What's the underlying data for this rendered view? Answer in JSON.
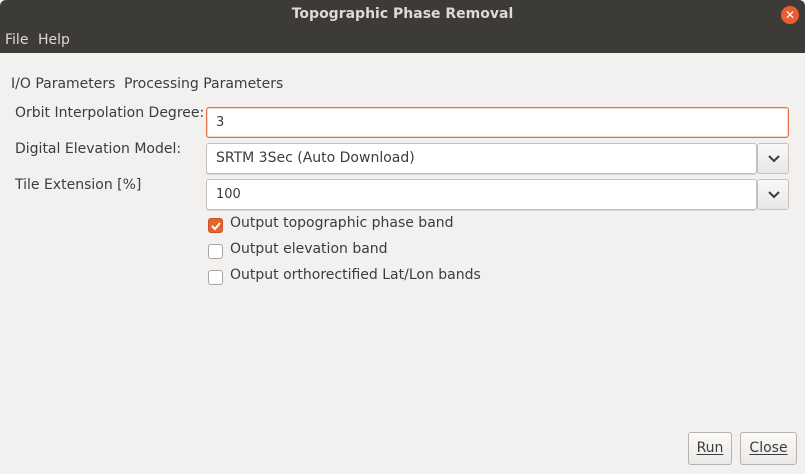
{
  "window": {
    "title": "Topographic Phase Removal",
    "close_glyph": "✕"
  },
  "menu": {
    "items": [
      "File",
      "Help"
    ]
  },
  "tabs": [
    "I/O Parameters",
    "Processing Parameters"
  ],
  "form": {
    "orbit_degree": {
      "label": "Orbit Interpolation Degree:",
      "value": "3"
    },
    "dem": {
      "label": "Digital Elevation Model:",
      "value": "SRTM 3Sec (Auto Download)"
    },
    "tile_extension": {
      "label": "Tile Extension [%]",
      "value": "100"
    },
    "checkboxes": [
      {
        "label": "Output topographic phase band",
        "checked": true
      },
      {
        "label": "Output elevation band",
        "checked": false
      },
      {
        "label": "Output orthorectified Lat/Lon bands",
        "checked": false
      }
    ]
  },
  "buttons": {
    "run": "Run",
    "close": "Close"
  },
  "colors": {
    "titlebar": "#3c3b37",
    "accent": "#e2642f",
    "window_bg": "#f2f1f0"
  }
}
